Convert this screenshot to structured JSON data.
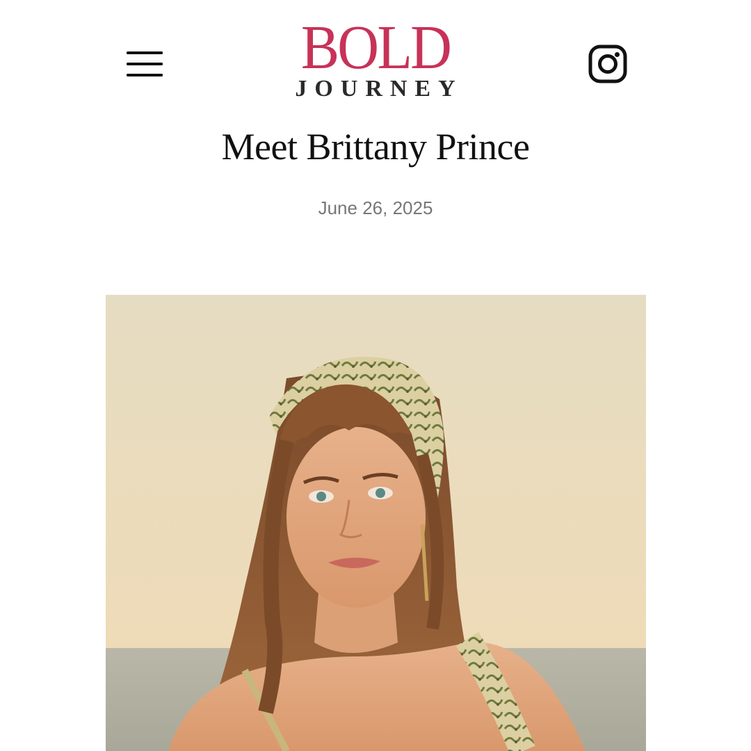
{
  "header": {
    "menu_icon": "hamburger-menu-icon",
    "logo": {
      "line1": "BOLD",
      "line2": "JOURNEY",
      "line1_color": "#c73258",
      "line2_color": "#2a2a2a"
    },
    "social_icon": "instagram-icon"
  },
  "article": {
    "title": "Meet Brittany Prince",
    "date": "June 26, 2025",
    "hero_image": "portrait-photo"
  },
  "colors": {
    "background": "#ffffff",
    "title_text": "#111111",
    "date_text": "#777777"
  }
}
